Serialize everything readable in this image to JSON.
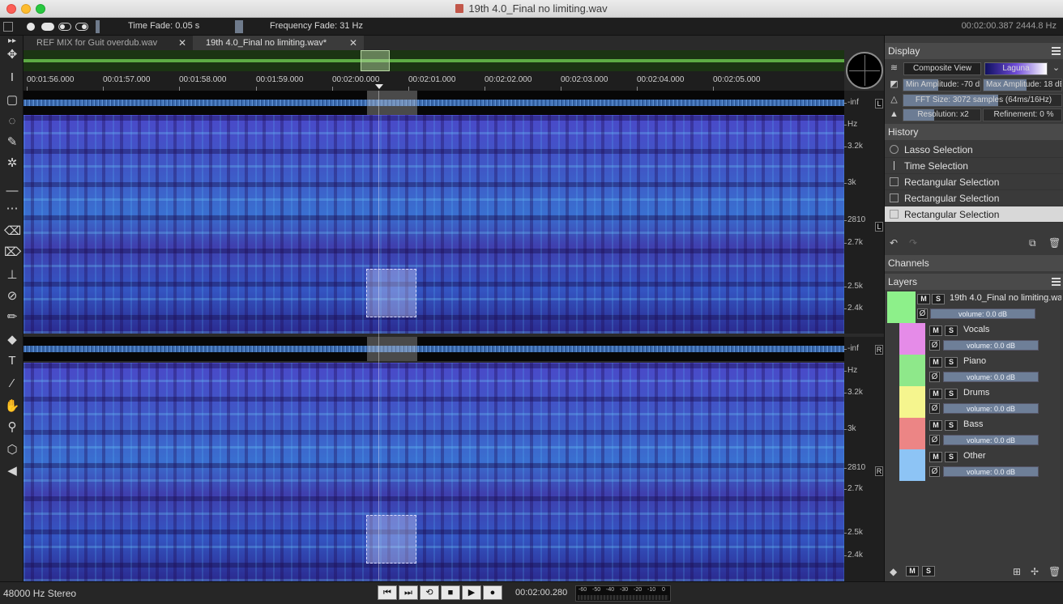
{
  "window": {
    "title": "19th 4.0_Final no limiting.wav"
  },
  "toolbar": {
    "time_fade": "Time Fade: 0.05 s",
    "frequency_fade": "Frequency Fade: 31 Hz",
    "cursor_readout": "00:02:00.387  2444.8 Hz"
  },
  "tabs": [
    {
      "label": "REF MIX for Guit overdub.wav",
      "close": "✕"
    },
    {
      "label": "19th 4.0_Final no limiting.wav*",
      "close": "✕"
    }
  ],
  "timeline": {
    "ticks": [
      "00:01:56.000",
      "00:01:57.000",
      "00:01:58.000",
      "00:01:59.000",
      "00:02:00.000",
      "00:02:01.000",
      "00:02:02.000",
      "00:02:03.000",
      "00:02:04.000",
      "00:02:05.000"
    ]
  },
  "channels": {
    "left": {
      "letter": "L",
      "inf": "-inf",
      "hz": "Hz",
      "scale": [
        "3.2k",
        "3k",
        "2810",
        "2.7k",
        "2.5k",
        "2.4k"
      ]
    },
    "right": {
      "letter": "R",
      "inf": "-inf",
      "hz": "Hz",
      "scale": [
        "3.2k",
        "3k",
        "2810",
        "2.7k",
        "2.5k",
        "2.4k"
      ]
    }
  },
  "status": {
    "format": "48000 Hz Stereo",
    "timecode": "00:02:00.280",
    "meter_labels": [
      "-60",
      "-50",
      "-40",
      "-30",
      "-20",
      "-10",
      "0"
    ]
  },
  "transport": [
    {
      "name": "skip-back",
      "glyph": "⏮"
    },
    {
      "name": "skip-forward",
      "glyph": "⏭"
    },
    {
      "name": "loop",
      "glyph": "⟲"
    },
    {
      "name": "stop",
      "glyph": "■"
    },
    {
      "name": "play",
      "glyph": "▶"
    },
    {
      "name": "record",
      "glyph": "●"
    }
  ],
  "display": {
    "title": "Display",
    "composite_view": "Composite View",
    "colormap": "Laguna",
    "min_amplitude": "Min Amplitude: -70 dB",
    "min_amplitude_fill": 0.45,
    "max_amplitude": "Max Amplitude: 18 dB",
    "max_amplitude_fill": 0.55,
    "fft_size": "FFT Size: 3072 samples (64ms/16Hz)",
    "fft_fill": 0.6,
    "resolution": "Resolution: x2",
    "resolution_fill": 0.4,
    "refinement": "Refinement: 0 %",
    "refinement_fill": 0.0
  },
  "history": {
    "title": "History",
    "items": [
      "Lasso Selection",
      "Time Selection",
      "Rectangular Selection",
      "Rectangular Selection",
      "Rectangular Selection"
    ]
  },
  "channels_section": {
    "title": "Channels"
  },
  "layers": {
    "title": "Layers",
    "master": {
      "name": "19th 4.0_Final no limiting.wav",
      "volume": "volume: 0.0 dB",
      "color": "#8df08a"
    },
    "items": [
      {
        "name": "Vocals",
        "volume": "volume: 0.0 dB",
        "color": "#e58be8"
      },
      {
        "name": "Piano",
        "volume": "volume: 0.0 dB",
        "color": "#8ee88a"
      },
      {
        "name": "Drums",
        "volume": "volume: 0.0 dB",
        "color": "#f5f58e"
      },
      {
        "name": "Bass",
        "volume": "volume: 0.0 dB",
        "color": "#ec8585"
      },
      {
        "name": "Other",
        "volume": "volume: 0.0 dB",
        "color": "#8dc4f5"
      }
    ],
    "mute_label": "M",
    "solo_label": "S",
    "phase_label": "Ø"
  },
  "colors": {
    "accent": "#6c7c94",
    "waveform": "#5f92d4",
    "overview": "#5dab44"
  }
}
